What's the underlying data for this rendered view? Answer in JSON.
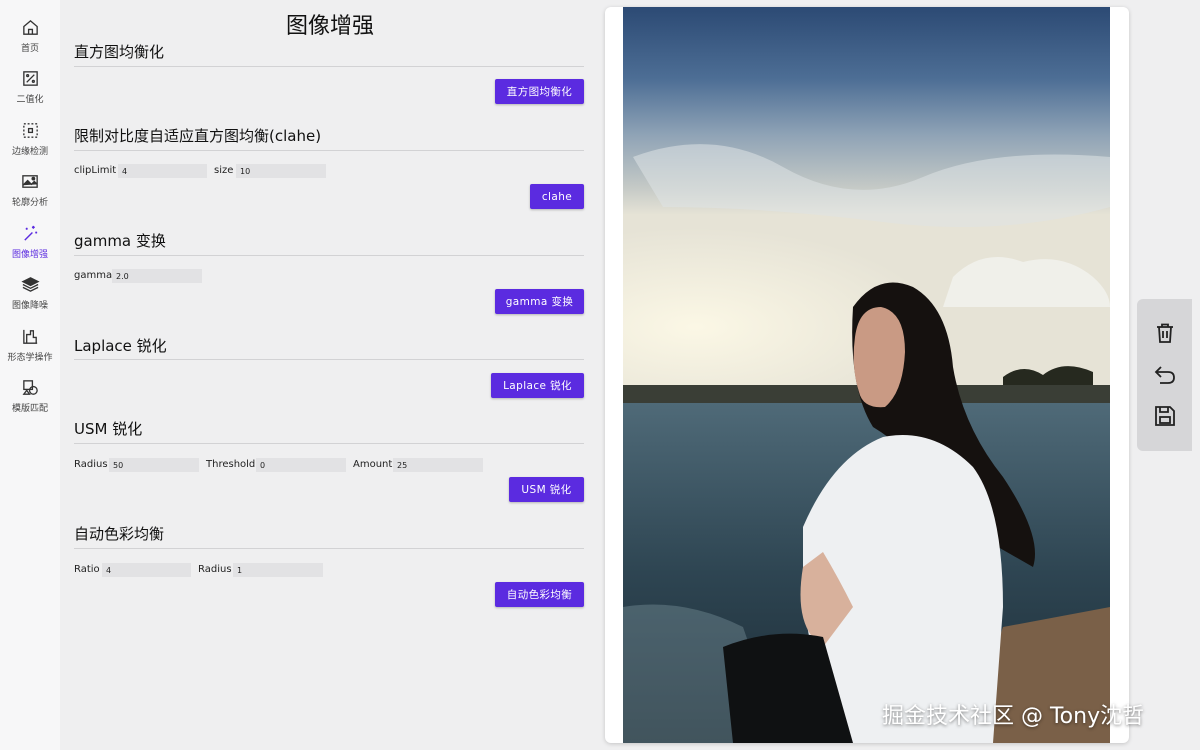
{
  "sidebar": {
    "items": [
      {
        "label": "首页",
        "icon": "home-icon"
      },
      {
        "label": "二值化",
        "icon": "percent-box-icon"
      },
      {
        "label": "边缘检测",
        "icon": "dashed-box-icon"
      },
      {
        "label": "轮廓分析",
        "icon": "image-edit-icon"
      },
      {
        "label": "图像增强",
        "icon": "magic-wand-icon",
        "active": true
      },
      {
        "label": "图像降噪",
        "icon": "layers-icon"
      },
      {
        "label": "形态学操作",
        "icon": "chart-shape-icon"
      },
      {
        "label": "模版匹配",
        "icon": "shapes-icon"
      }
    ]
  },
  "page": {
    "title": "图像增强"
  },
  "sections": {
    "hist_eq": {
      "title": "直方图均衡化",
      "button": "直方图均衡化"
    },
    "clahe": {
      "title": "限制对比度自适应直方图均衡(clahe)",
      "button": "clahe",
      "fields": [
        {
          "label": "clipLimit",
          "value": "4"
        },
        {
          "label": "size",
          "value": "10"
        }
      ]
    },
    "gamma": {
      "title": "gamma 变换",
      "button": "gamma 变换",
      "fields": [
        {
          "label": "gamma",
          "value": "2.0"
        }
      ]
    },
    "laplace": {
      "title": "Laplace 锐化",
      "button": "Laplace 锐化"
    },
    "usm": {
      "title": "USM 锐化",
      "button": "USM 锐化",
      "fields": [
        {
          "label": "Radius",
          "value": "50"
        },
        {
          "label": "Threshold",
          "value": "0"
        },
        {
          "label": "Amount",
          "value": "25"
        }
      ]
    },
    "acb": {
      "title": "自动色彩均衡",
      "button": "自动色彩均衡",
      "fields": [
        {
          "label": "Ratio",
          "value": "4"
        },
        {
          "label": "Radius",
          "value": "1"
        }
      ]
    }
  },
  "watermark": "掘金技术社区 @ Tony沈哲",
  "tools": [
    {
      "icon": "trash-icon"
    },
    {
      "icon": "undo-icon"
    },
    {
      "icon": "save-icon"
    }
  ],
  "colors": {
    "accent": "#5b2be0",
    "background": "#efeff0",
    "sidebar": "#f7f7f8"
  }
}
